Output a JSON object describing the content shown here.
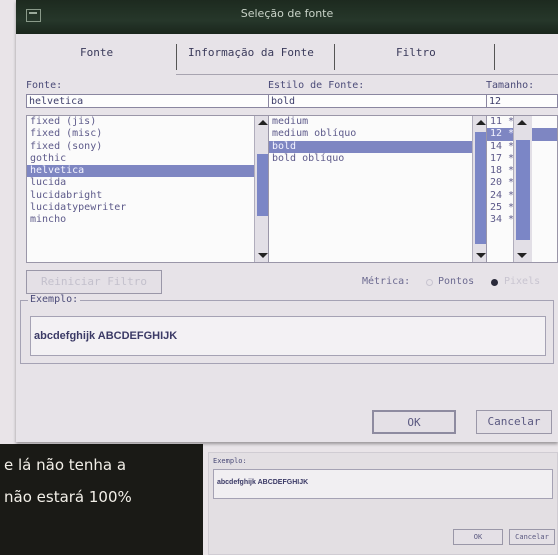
{
  "window": {
    "title": "Seleção de fonte"
  },
  "tabs": [
    "Fonte",
    "Informação da Fonte",
    "Filtro"
  ],
  "font": {
    "label": "Fonte:",
    "value": "helvetica",
    "items": [
      "fixed (jis)",
      "fixed (misc)",
      "fixed (sony)",
      "gothic",
      "helvetica",
      "lucida",
      "lucidabright",
      "lucidatypewriter",
      "mincho"
    ],
    "selected_index": 4
  },
  "style": {
    "label": "Estilo de Fonte:",
    "value": "bold",
    "items": [
      "medium",
      "medium oblíquo",
      "bold",
      "bold oblíquo"
    ],
    "selected_index": 2
  },
  "size": {
    "label": "Tamanho:",
    "value": "12",
    "items": [
      "11 *",
      "12 *",
      "14 *",
      "17 *",
      "18 *",
      "20 *",
      "24 *",
      "25 *",
      "34 *"
    ],
    "selected_index": 1
  },
  "reset_filter_label": "Reiniciar Filtro",
  "metrics": {
    "label": "Métrica:",
    "points": "Pontos",
    "pixels": "Pixels",
    "selected": "Pixels"
  },
  "example": {
    "label": "Exemplo:",
    "sample_text": "abcdefghijk ABCDEFGHIJK"
  },
  "buttons": {
    "ok": "OK",
    "cancel": "Cancelar"
  },
  "bg_text": [
    "e lá não tenha a",
    "não estará 100%"
  ],
  "colors": {
    "titlebar": "#1d2a1f",
    "selection": "#7e86c2",
    "text": "#4b4b78"
  },
  "icons": [
    "window-menu-icon",
    "scroll-up-icon",
    "scroll-down-icon"
  ]
}
